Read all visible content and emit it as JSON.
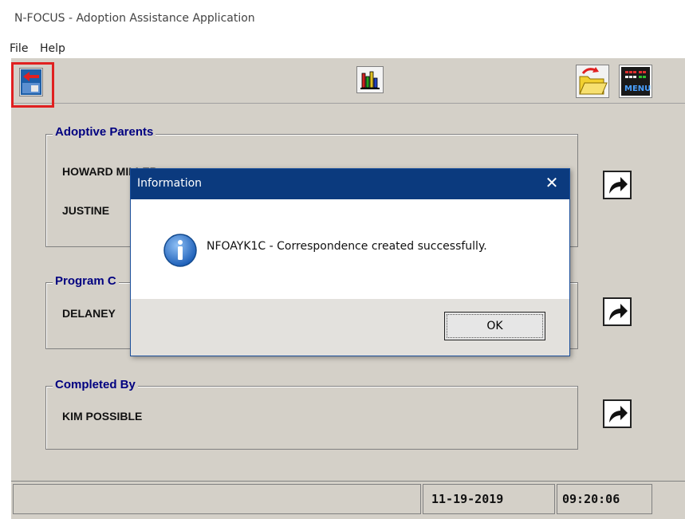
{
  "window": {
    "title": "N-FOCUS - Adoption Assistance Application"
  },
  "menu": {
    "items": [
      {
        "label": "File"
      },
      {
        "label": "Help"
      }
    ]
  },
  "toolbar": {
    "buttons": [
      {
        "icon": "exit-icon",
        "highlighted": true
      },
      {
        "icon": "bar-chart-icon"
      },
      {
        "icon": "open-folder-icon"
      },
      {
        "icon": "menu-icon",
        "label": "MENU"
      }
    ]
  },
  "groups": {
    "adoptive_parents": {
      "label": "Adoptive Parents",
      "names": [
        "HOWARD MILLER",
        "JUSTINE"
      ]
    },
    "program": {
      "label": "Program C",
      "names": [
        "DELANEY"
      ]
    },
    "completed_by": {
      "label": "Completed By",
      "names": [
        "KIM POSSIBLE"
      ]
    }
  },
  "status": {
    "date": "11-19-2019",
    "time": "09:20:06"
  },
  "dialog": {
    "title": "Information",
    "message": "NFOAYK1C - Correspondence created successfully.",
    "ok_label": "OK",
    "icon": "info-icon"
  },
  "colors": {
    "accent": "#0b3a7e",
    "group_label": "#000080",
    "highlight": "#e02020"
  }
}
